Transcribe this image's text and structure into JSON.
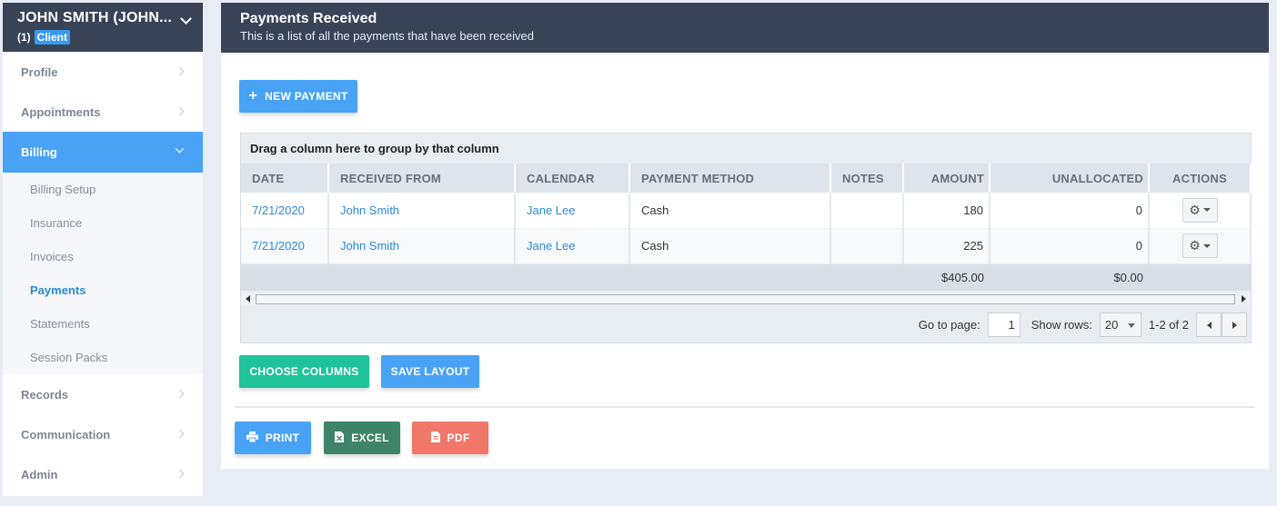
{
  "client": {
    "name": "JOHN SMITH (JOHN...",
    "count": "(1)",
    "badge": "Client"
  },
  "sidebar": {
    "items": [
      {
        "label": "Profile"
      },
      {
        "label": "Appointments"
      },
      {
        "label": "Billing"
      },
      {
        "label": "Records"
      },
      {
        "label": "Communication"
      },
      {
        "label": "Admin"
      }
    ],
    "billing_sub": [
      {
        "label": "Billing Setup"
      },
      {
        "label": "Insurance"
      },
      {
        "label": "Invoices"
      },
      {
        "label": "Payments"
      },
      {
        "label": "Statements"
      },
      {
        "label": "Session Packs"
      }
    ]
  },
  "header": {
    "title": "Payments Received",
    "subtitle": "This is a list of all the payments that have been received"
  },
  "buttons": {
    "new_payment": "NEW PAYMENT",
    "choose_columns": "CHOOSE COLUMNS",
    "save_layout": "SAVE LAYOUT",
    "print": "PRINT",
    "excel": "EXCEL",
    "pdf": "PDF"
  },
  "grid": {
    "group_hint": "Drag a column here to group by that column",
    "columns": [
      "DATE",
      "RECEIVED FROM",
      "CALENDAR",
      "PAYMENT METHOD",
      "NOTES",
      "AMOUNT",
      "UNALLOCATED",
      "ACTIONS"
    ],
    "rows": [
      {
        "date": "7/21/2020",
        "received_from": "John Smith",
        "calendar": "Jane Lee",
        "method": "Cash",
        "notes": "",
        "amount": "180",
        "unallocated": "0"
      },
      {
        "date": "7/21/2020",
        "received_from": "John Smith",
        "calendar": "Jane Lee",
        "method": "Cash",
        "notes": "",
        "amount": "225",
        "unallocated": "0"
      }
    ],
    "totals": {
      "amount": "$405.00",
      "unallocated": "$0.00"
    }
  },
  "pager": {
    "goto_label": "Go to page:",
    "page_value": "1",
    "rows_label": "Show rows:",
    "rows_value": "20",
    "range": "1-2 of 2"
  },
  "colors": {
    "header_bg": "#384456",
    "accent_blue": "#48a3f7",
    "green": "#1fc39a",
    "excel": "#3d8468",
    "pdf": "#f0776a",
    "link": "#2b8ad8"
  }
}
